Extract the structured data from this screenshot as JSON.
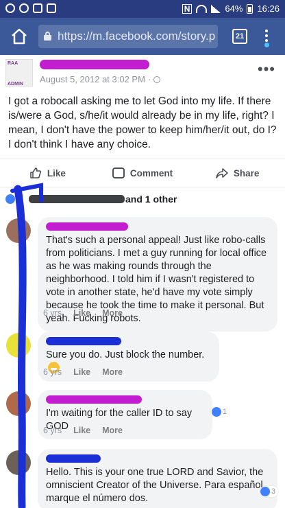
{
  "status_bar": {
    "battery": "64%",
    "time": "16:26",
    "nfc": "N"
  },
  "browser": {
    "url": "https://m.facebook.com/story.p",
    "tab_count": "21"
  },
  "post": {
    "avatar_text_top": "RAA",
    "avatar_text_bottom": "ADMIN",
    "date": "August 5, 2012 at 3:02 PM",
    "separator": "·",
    "text": "I got a robocall asking me to let God into my life. If there is/were a God, s/he/it would already be in my life, right? I mean, I don't have the power to keep him/her/it out, do I? I don't think I have any choice.",
    "more": "•••"
  },
  "actions": {
    "like": "Like",
    "comment": "Comment",
    "share": "Share"
  },
  "likes": {
    "suffix": "and 1 other"
  },
  "comments": [
    {
      "text": "That's such a personal appeal! Just like robo-calls from politicians. I met a guy running for local office as he was making rounds through the neighborhood. I told him if I wasn't registered to vote in another state, he'd have my vote simply because he took the time to make it personal. But yeah. Fucking robots.",
      "age": "6 yrs",
      "like": "Like",
      "more": "More"
    },
    {
      "text": "Sure you do. Just block the number.",
      "age": "6 yrs",
      "like": "Like",
      "more": "More"
    },
    {
      "text": "I'm waiting for the caller ID to say GOD",
      "age": "6 yrs",
      "like": "Like",
      "more": "More",
      "reactions": "1"
    },
    {
      "text": "Hello. This is your one true LORD and Savior, the omniscient Creator of the Universe. Para español, marque el número dos.",
      "reactions": "3"
    }
  ],
  "colors": {
    "facebook_blue": "#3b5998",
    "status_bar": "#2a3c80",
    "redaction_magenta": "#c21ecf",
    "scribble_blue": "#1a2fd6"
  }
}
